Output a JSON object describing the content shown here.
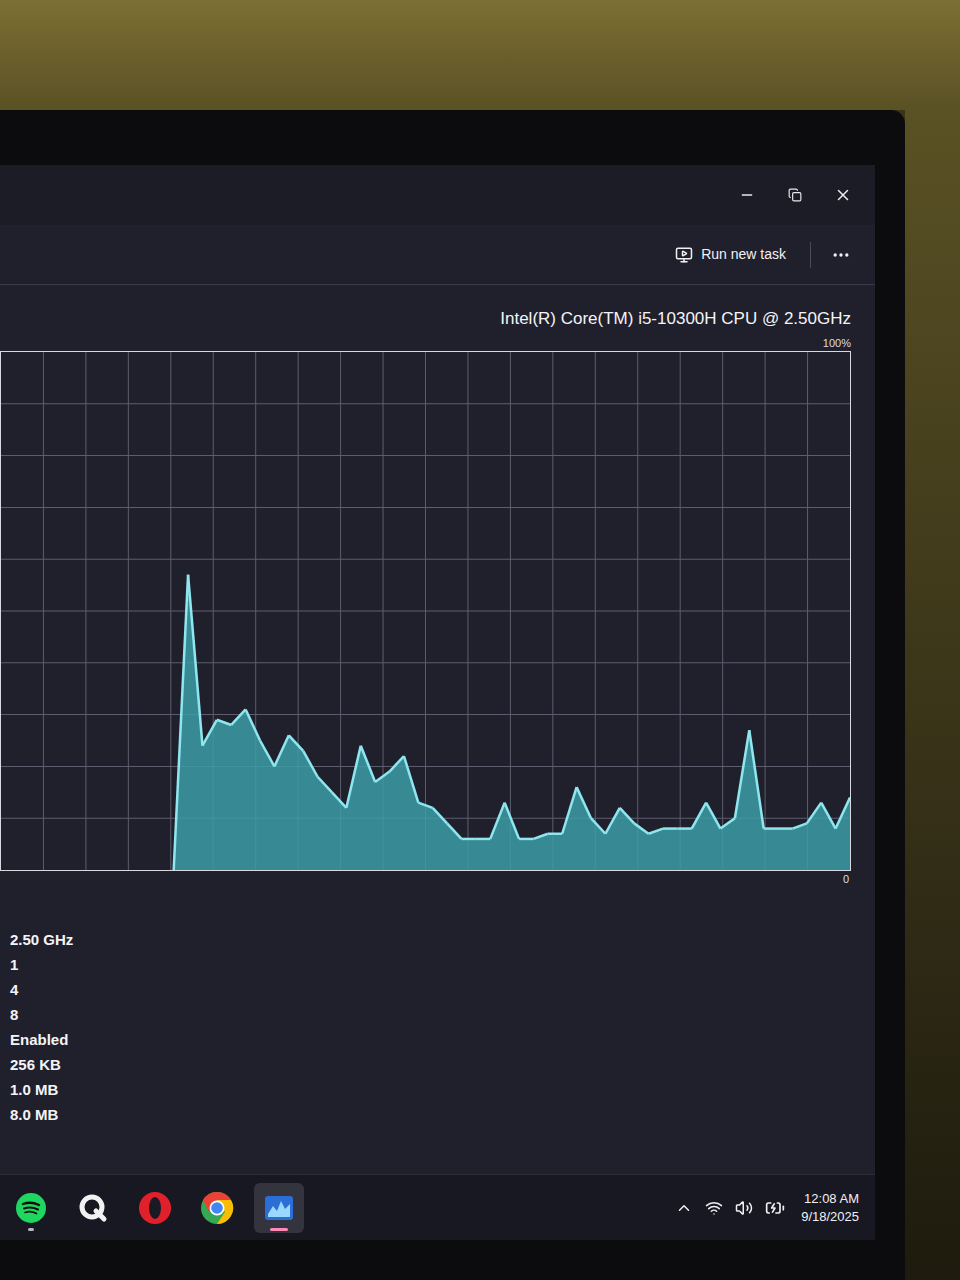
{
  "toolbar": {
    "run_new_task": "Run new task"
  },
  "cpu": {
    "name": "Intel(R) Core(TM) i5-10300H CPU @ 2.50GHz"
  },
  "chart": {
    "max_label": "100%",
    "min_label": "0",
    "max": 100,
    "values": [
      0,
      57,
      24,
      29,
      28,
      31,
      25,
      20,
      26,
      23,
      18,
      15,
      12,
      24,
      17,
      19,
      22,
      13,
      12,
      9,
      6,
      6,
      6,
      13,
      6,
      6,
      7,
      7,
      16,
      10,
      7,
      12,
      9,
      7,
      8,
      8,
      8,
      13,
      8,
      10,
      27,
      8,
      8,
      8,
      9,
      13,
      8,
      14
    ]
  },
  "specs": [
    "2.50 GHz",
    "1",
    "4",
    "8",
    "Enabled",
    "256 KB",
    "1.0 MB",
    "8.0 MB"
  ],
  "taskbar": {
    "apps": [
      {
        "kind": "spotify",
        "running": true,
        "selected": false
      },
      {
        "kind": "q-app",
        "running": false,
        "selected": false
      },
      {
        "kind": "opera",
        "running": false,
        "selected": false
      },
      {
        "kind": "chrome",
        "running": false,
        "selected": false
      },
      {
        "kind": "task-manager",
        "running": true,
        "selected": true
      }
    ]
  },
  "tray": {
    "time": "12:08 AM",
    "date": "9/18/2025"
  }
}
